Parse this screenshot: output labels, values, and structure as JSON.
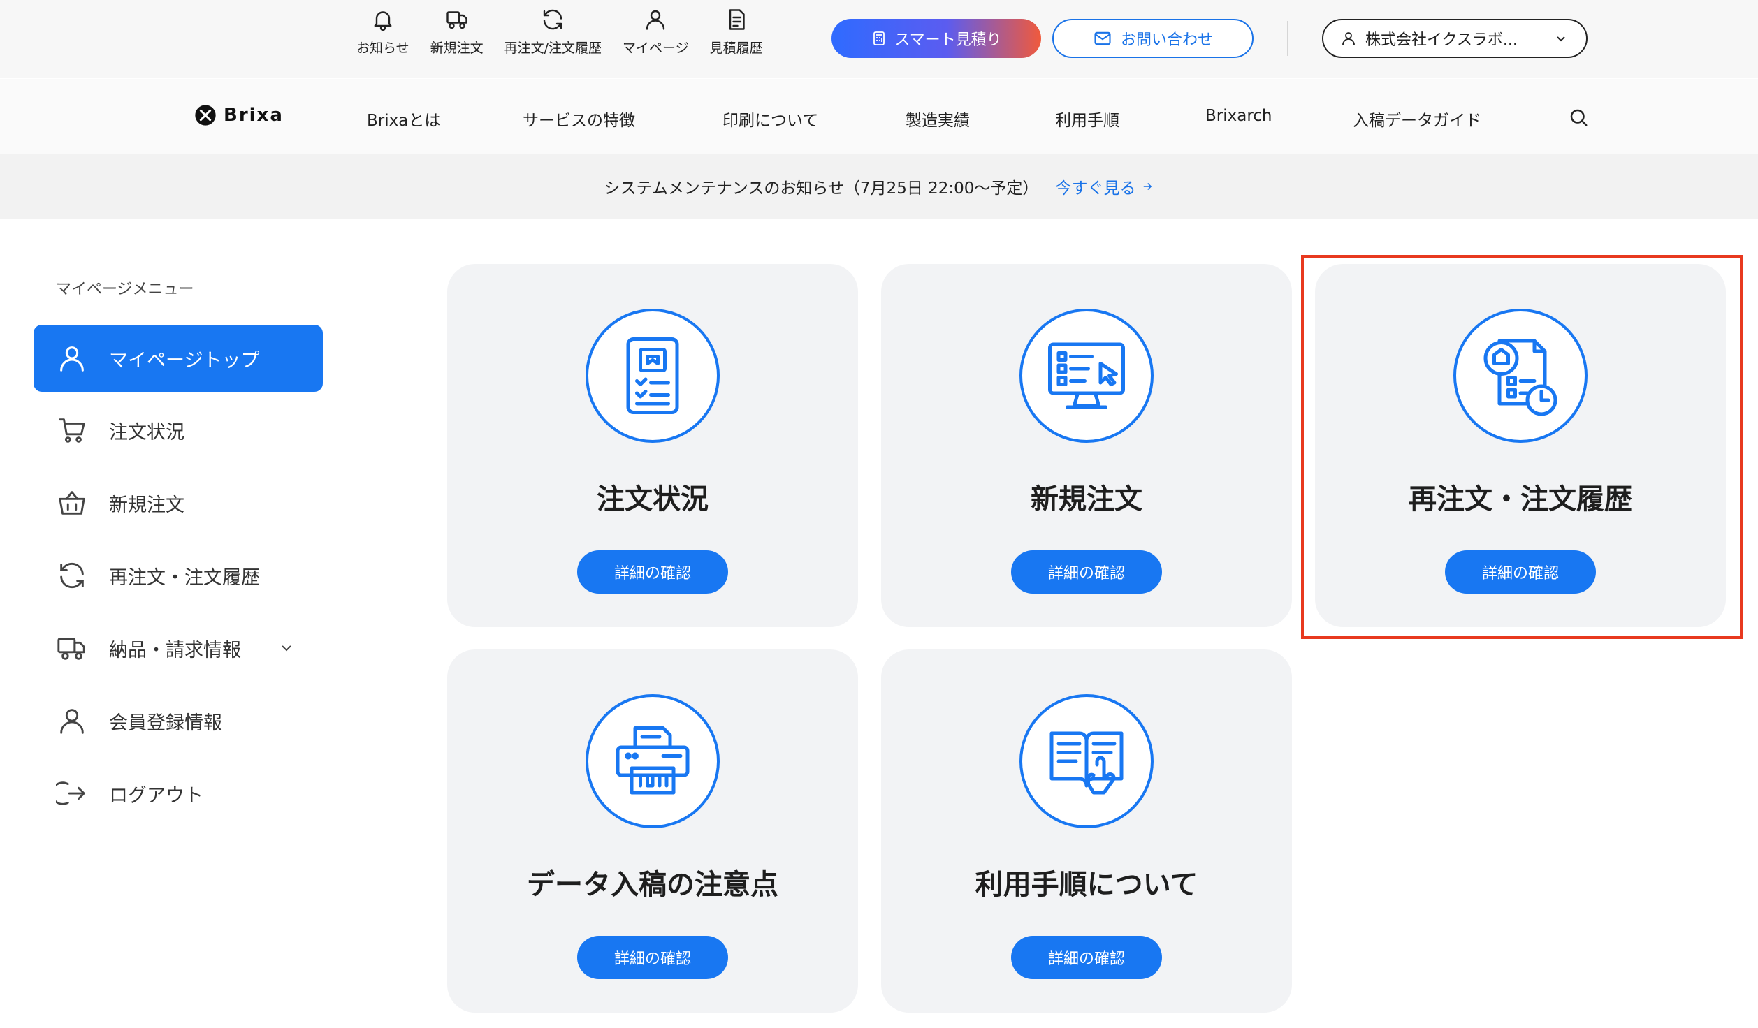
{
  "utility": {
    "items": [
      {
        "label": "お知らせ",
        "icon": "bell-icon"
      },
      {
        "label": "新規注文",
        "icon": "truck-icon"
      },
      {
        "label": "再注文/注文履歴",
        "icon": "refresh-icon"
      },
      {
        "label": "マイページ",
        "icon": "user-icon"
      },
      {
        "label": "見積履歴",
        "icon": "document-icon"
      }
    ],
    "smart_label": "スマート見積り",
    "contact_label": "お問い合わせ",
    "account_label": "株式会社イクスラボ..."
  },
  "brand": {
    "name": "Brixa"
  },
  "nav": {
    "items": [
      "Brixaとは",
      "サービスの特徴",
      "印刷について",
      "製造実績",
      "利用手順",
      "Brixarch",
      "入稿データガイド"
    ]
  },
  "notice": {
    "text": "システムメンテナンスのお知らせ（7月25日 22:00〜予定）",
    "link_label": "今すぐ見る"
  },
  "sidebar": {
    "heading": "マイページメニュー",
    "items": [
      {
        "label": "マイページトップ",
        "icon": "user-icon",
        "active": true
      },
      {
        "label": "注文状況",
        "icon": "cart-icon"
      },
      {
        "label": "新規注文",
        "icon": "basket-icon"
      },
      {
        "label": "再注文・注文履歴",
        "icon": "refresh-icon"
      },
      {
        "label": "納品・請求情報",
        "icon": "truck-icon",
        "expandable": true
      },
      {
        "label": "会員登録情報",
        "icon": "user-icon"
      },
      {
        "label": "ログアウト",
        "icon": "logout-icon"
      }
    ]
  },
  "cards": [
    {
      "title": "注文状況",
      "button": "詳細の確認",
      "icon": "tablet-checklist-icon"
    },
    {
      "title": "新規注文",
      "button": "詳細の確認",
      "icon": "monitor-form-icon"
    },
    {
      "title": "再注文・注文履歴",
      "button": "詳細の確認",
      "icon": "order-history-icon",
      "highlighted": true
    },
    {
      "title": "データ入稿の注意点",
      "button": "詳細の確認",
      "icon": "printer-icon"
    },
    {
      "title": "利用手順について",
      "button": "詳細の確認",
      "icon": "book-hand-icon"
    }
  ],
  "colors": {
    "primary": "#1877f2",
    "highlight": "#e8391f",
    "card_bg": "#f2f3f5",
    "notice_bg": "#f2f2f2"
  }
}
